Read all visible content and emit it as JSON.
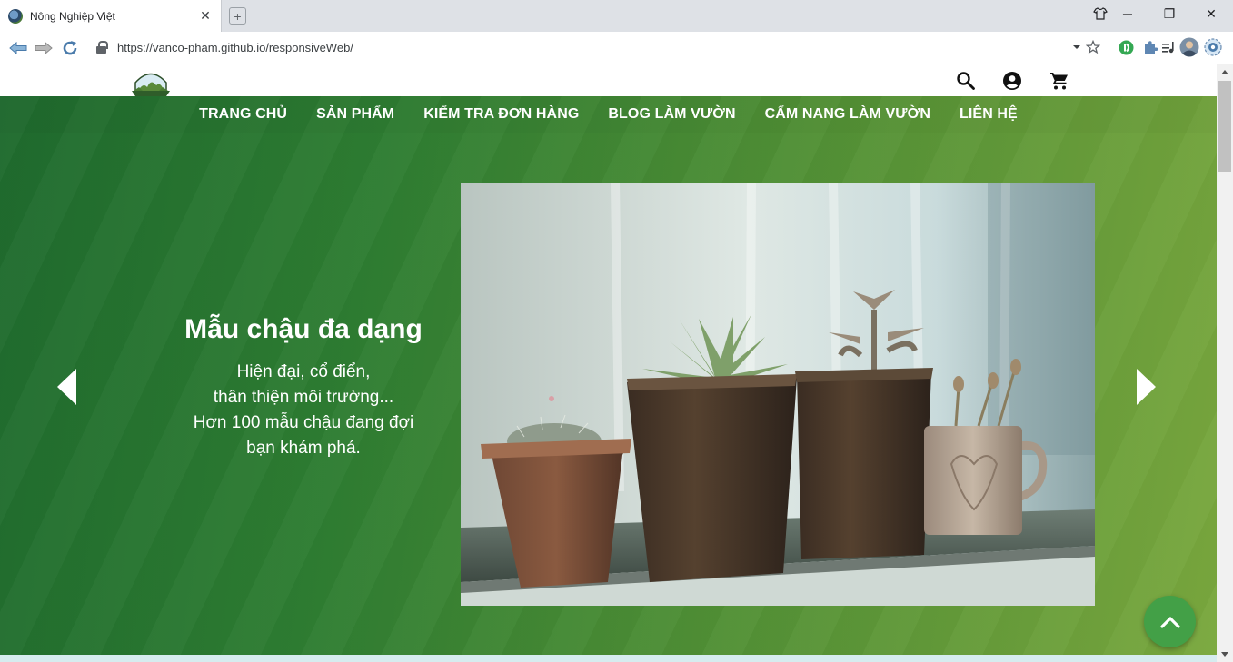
{
  "browser": {
    "tab_title": "Nông Nghiệp Việt",
    "tab_close": "✕",
    "new_tab": "+",
    "url": "https://vanco-pham.github.io/responsiveWeb/",
    "window_minimize": "─",
    "window_restore": "❐",
    "window_close": "✕"
  },
  "header": {
    "icons": [
      "search-icon",
      "account-icon",
      "cart-icon"
    ]
  },
  "menu": [
    {
      "label": "TRANG CHỦ"
    },
    {
      "label": "SẢN PHẨM"
    },
    {
      "label": "KIỂM TRA ĐƠN HÀNG"
    },
    {
      "label": "BLOG LÀM VƯỜN"
    },
    {
      "label": "CẨM NANG LÀM VƯỜN"
    },
    {
      "label": "LIÊN HỆ"
    }
  ],
  "slide": {
    "title": "Mẫu chậu đa dạng",
    "line1": "Hiện đại, cổ điển,",
    "line2": "thân thiện môi trường...",
    "line3": "Hơn 100 mẫu chậu đang đợi",
    "line4": "bạn khám phá."
  },
  "colors": {
    "hero_dark": "#1f6b2e",
    "hero_light": "#7aa83e",
    "back_to_top": "#43a047"
  }
}
